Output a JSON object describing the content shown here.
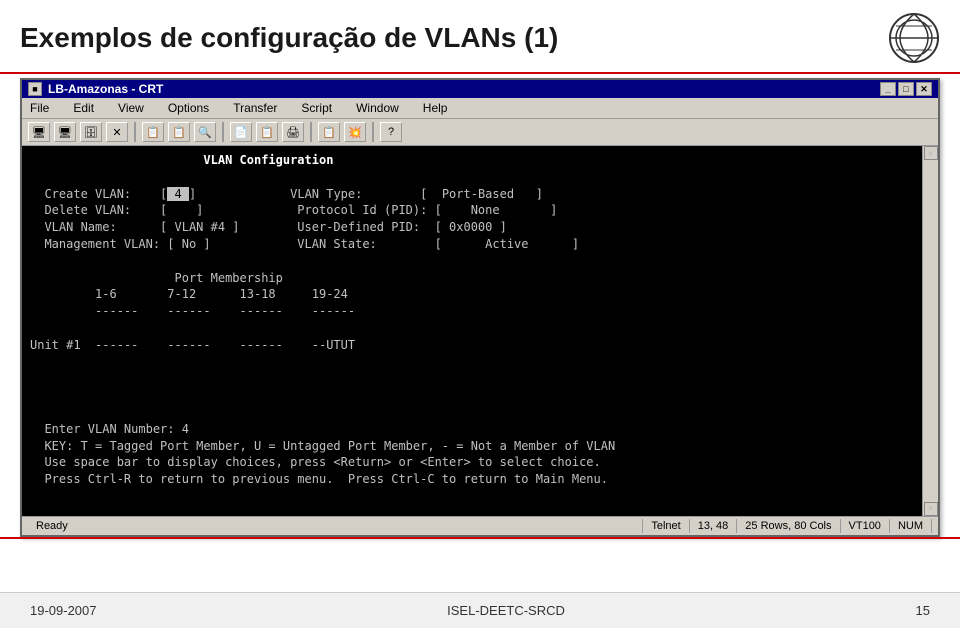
{
  "header": {
    "title": "Exemplos de configuração de VLANs (1)"
  },
  "window": {
    "titlebar": {
      "title": "LB-Amazonas - CRT",
      "btn_min": "_",
      "btn_max": "□",
      "btn_close": "✕"
    },
    "menubar": {
      "items": [
        "File",
        "Edit",
        "View",
        "Options",
        "Transfer",
        "Script",
        "Window",
        "Help"
      ]
    },
    "toolbar": {
      "icons": [
        "📄",
        "📂",
        "💾",
        "✕",
        "📋",
        "📋",
        "🔍",
        "📄",
        "📋",
        "🖨",
        "📋",
        "💥",
        "❓"
      ]
    },
    "terminal": {
      "content_title": "VLAN Configuration",
      "line1_label1": "Create VLAN:",
      "line1_val1": " 4 ",
      "line1_label2": "VLAN Type:",
      "line1_val2": " Port-Based   ",
      "line2_label1": "Delete VLAN:",
      "line2_val1": "   ",
      "line2_label2": "Protocol Id (PID):",
      "line2_val2": "  None        ",
      "line3_label1": "VLAN Name:",
      "line3_val1": " VLAN #4 ",
      "line3_label2": "User-Defined PID:",
      "line3_val2": " 0x0000 ",
      "line4_label1": "Management VLAN:",
      "line4_val1": " No ",
      "line4_label2": "VLAN State:",
      "line4_val2": "      Active      ",
      "port_membership_header": "Port Membership",
      "col1": "1-6",
      "col2": "7-12",
      "col3": "13-18",
      "col4": "19-24",
      "dashes1": "------",
      "dashes2": "------",
      "dashes3": "------",
      "dashes4": "------",
      "unit_label": "Unit #1",
      "unit_dashes1": "------",
      "unit_dashes2": "------",
      "unit_dashes3": "------",
      "unit_val4": "--UTUT",
      "status1": "Enter VLAN Number: 4",
      "status2": "KEY: T = Tagged Port Member, U = Untagged Port Member, - = Not a Member of VLAN",
      "status3": "Use space bar to display choices, press <Return> or <Enter> to select choice.",
      "status4": "Press Ctrl-R to return to previous menu.  Press Ctrl-C to return to Main Menu."
    },
    "statusbar": {
      "ready": "Ready",
      "protocol": "Telnet",
      "position": "13, 48",
      "size": "25 Rows, 80 Cols",
      "terminal": "VT100",
      "num": "NUM"
    }
  },
  "footer": {
    "date": "19-09-2007",
    "center": "ISEL-DEETC-SRCD",
    "page": "15"
  }
}
